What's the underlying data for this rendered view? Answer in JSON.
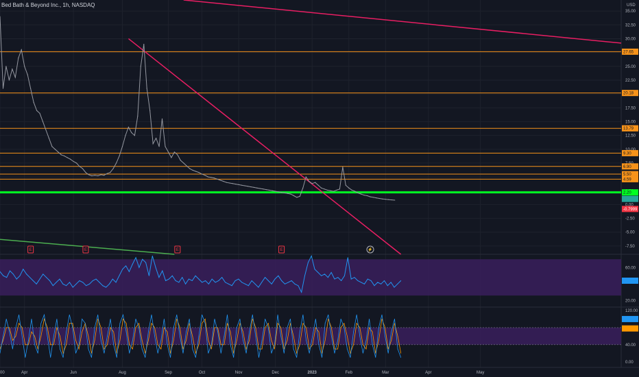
{
  "window": {
    "title": "Bed Bath & Beyond Inc., 1h, NASDAQ"
  },
  "colors": {
    "background": "#131722",
    "price": "#9598a1",
    "resistance": "#f7931a",
    "support": "#00ff22",
    "trendline": "#e91e63",
    "rsi_line": "#2196f3",
    "rsi_band": "#3a1f5c",
    "stoch_k": "#2196f3",
    "stoch_d": "#ff9800",
    "earnings": "#f23645"
  },
  "chart_data": [
    {
      "type": "line",
      "title": "Bed Bath & Beyond Inc., 1h, NASDAQ",
      "currency_label": "USD",
      "x_tick_labels": [
        "00",
        "Apr",
        "Jun",
        "Aug",
        "Sep",
        "Oct",
        "Nov",
        "Dec",
        "2023",
        "Feb",
        "Mar",
        "Apr",
        "May"
      ],
      "x_tick_index": [
        0,
        8,
        24,
        40,
        55,
        66,
        78,
        90,
        102,
        114,
        126,
        140,
        157
      ],
      "y_ticks": [
        35.0,
        32.5,
        30.0,
        27.5,
        25.0,
        22.5,
        20.0,
        17.5,
        15.0,
        12.5,
        10.0,
        7.5,
        5.0,
        2.5,
        0.0,
        -2.5,
        -5.0,
        -7.5
      ],
      "y_tick_labels": [
        "35.00",
        "32.50",
        "30.00",
        "27.50",
        "25.00",
        "22.50",
        "20.00",
        "17.50",
        "15.00",
        "12.50",
        "10.00",
        "7.50",
        "5.00",
        "2.50",
        "0.00",
        "-2.50",
        "-5.00",
        "-7.50"
      ],
      "ylim": [
        -9.0,
        37.0
      ],
      "price_series": [
        {
          "i": 0,
          "v": 34.0
        },
        {
          "i": 1,
          "v": 21.0
        },
        {
          "i": 2,
          "v": 25.0
        },
        {
          "i": 3,
          "v": 22.5
        },
        {
          "i": 4,
          "v": 24.5
        },
        {
          "i": 5,
          "v": 23.0
        },
        {
          "i": 6,
          "v": 26.5
        },
        {
          "i": 7,
          "v": 28.0
        },
        {
          "i": 8,
          "v": 25.0
        },
        {
          "i": 9,
          "v": 23.5
        },
        {
          "i": 10,
          "v": 21.0
        },
        {
          "i": 11,
          "v": 18.5
        },
        {
          "i": 12,
          "v": 17.0
        },
        {
          "i": 13,
          "v": 16.5
        },
        {
          "i": 14,
          "v": 15.0
        },
        {
          "i": 15,
          "v": 13.5
        },
        {
          "i": 16,
          "v": 12.0
        },
        {
          "i": 17,
          "v": 10.5
        },
        {
          "i": 18,
          "v": 10.0
        },
        {
          "i": 19,
          "v": 9.5
        },
        {
          "i": 20,
          "v": 9.0
        },
        {
          "i": 21,
          "v": 8.8
        },
        {
          "i": 22,
          "v": 8.5
        },
        {
          "i": 23,
          "v": 8.2
        },
        {
          "i": 24,
          "v": 7.8
        },
        {
          "i": 25,
          "v": 7.5
        },
        {
          "i": 26,
          "v": 6.9
        },
        {
          "i": 27,
          "v": 6.5
        },
        {
          "i": 28,
          "v": 5.8
        },
        {
          "i": 29,
          "v": 5.4
        },
        {
          "i": 30,
          "v": 5.2
        },
        {
          "i": 31,
          "v": 5.3
        },
        {
          "i": 32,
          "v": 5.2
        },
        {
          "i": 33,
          "v": 5.4
        },
        {
          "i": 34,
          "v": 5.3
        },
        {
          "i": 35,
          "v": 5.6
        },
        {
          "i": 36,
          "v": 5.8
        },
        {
          "i": 37,
          "v": 6.5
        },
        {
          "i": 38,
          "v": 7.5
        },
        {
          "i": 39,
          "v": 8.8
        },
        {
          "i": 40,
          "v": 10.5
        },
        {
          "i": 41,
          "v": 12.5
        },
        {
          "i": 42,
          "v": 14.0
        },
        {
          "i": 43,
          "v": 13.0
        },
        {
          "i": 44,
          "v": 12.5
        },
        {
          "i": 45,
          "v": 16.0
        },
        {
          "i": 46,
          "v": 25.0
        },
        {
          "i": 47,
          "v": 29.0
        },
        {
          "i": 48,
          "v": 21.0
        },
        {
          "i": 49,
          "v": 17.0
        },
        {
          "i": 50,
          "v": 11.0
        },
        {
          "i": 51,
          "v": 12.0
        },
        {
          "i": 52,
          "v": 10.5
        },
        {
          "i": 53,
          "v": 15.5
        },
        {
          "i": 54,
          "v": 10.5
        },
        {
          "i": 55,
          "v": 9.5
        },
        {
          "i": 56,
          "v": 8.5
        },
        {
          "i": 57,
          "v": 9.5
        },
        {
          "i": 58,
          "v": 9.0
        },
        {
          "i": 59,
          "v": 8.0
        },
        {
          "i": 60,
          "v": 7.5
        },
        {
          "i": 61,
          "v": 7.0
        },
        {
          "i": 62,
          "v": 6.5
        },
        {
          "i": 63,
          "v": 6.2
        },
        {
          "i": 64,
          "v": 6.0
        },
        {
          "i": 65,
          "v": 5.8
        },
        {
          "i": 66,
          "v": 5.5
        },
        {
          "i": 67,
          "v": 5.3
        },
        {
          "i": 68,
          "v": 5.0
        },
        {
          "i": 69,
          "v": 4.9
        },
        {
          "i": 70,
          "v": 4.8
        },
        {
          "i": 71,
          "v": 4.6
        },
        {
          "i": 72,
          "v": 4.4
        },
        {
          "i": 73,
          "v": 4.2
        },
        {
          "i": 74,
          "v": 4.0
        },
        {
          "i": 75,
          "v": 3.9
        },
        {
          "i": 76,
          "v": 3.8
        },
        {
          "i": 77,
          "v": 3.7
        },
        {
          "i": 78,
          "v": 3.6
        },
        {
          "i": 79,
          "v": 3.5
        },
        {
          "i": 80,
          "v": 3.4
        },
        {
          "i": 81,
          "v": 3.3
        },
        {
          "i": 82,
          "v": 3.2
        },
        {
          "i": 83,
          "v": 3.1
        },
        {
          "i": 84,
          "v": 3.0
        },
        {
          "i": 85,
          "v": 2.9
        },
        {
          "i": 86,
          "v": 2.8
        },
        {
          "i": 87,
          "v": 2.7
        },
        {
          "i": 88,
          "v": 2.6
        },
        {
          "i": 89,
          "v": 2.5
        },
        {
          "i": 90,
          "v": 2.4
        },
        {
          "i": 91,
          "v": 2.3
        },
        {
          "i": 92,
          "v": 2.2
        },
        {
          "i": 93,
          "v": 2.1
        },
        {
          "i": 94,
          "v": 2.0
        },
        {
          "i": 95,
          "v": 1.9
        },
        {
          "i": 96,
          "v": 1.6
        },
        {
          "i": 97,
          "v": 1.3
        },
        {
          "i": 98,
          "v": 1.5
        },
        {
          "i": 99,
          "v": 3.0
        },
        {
          "i": 100,
          "v": 5.0
        },
        {
          "i": 101,
          "v": 4.2
        },
        {
          "i": 102,
          "v": 3.8
        },
        {
          "i": 103,
          "v": 4.0
        },
        {
          "i": 104,
          "v": 3.5
        },
        {
          "i": 105,
          "v": 3.0
        },
        {
          "i": 106,
          "v": 2.8
        },
        {
          "i": 107,
          "v": 2.6
        },
        {
          "i": 108,
          "v": 2.5
        },
        {
          "i": 109,
          "v": 2.4
        },
        {
          "i": 110,
          "v": 2.6
        },
        {
          "i": 111,
          "v": 2.8
        },
        {
          "i": 112,
          "v": 6.8
        },
        {
          "i": 113,
          "v": 3.5
        },
        {
          "i": 114,
          "v": 3.0
        },
        {
          "i": 115,
          "v": 2.6
        },
        {
          "i": 116,
          "v": 2.4
        },
        {
          "i": 117,
          "v": 2.1
        },
        {
          "i": 118,
          "v": 1.9
        },
        {
          "i": 119,
          "v": 1.7
        },
        {
          "i": 120,
          "v": 1.6
        },
        {
          "i": 121,
          "v": 1.4
        },
        {
          "i": 122,
          "v": 1.3
        },
        {
          "i": 123,
          "v": 1.2
        },
        {
          "i": 124,
          "v": 1.1
        },
        {
          "i": 125,
          "v": 1.0
        },
        {
          "i": 126,
          "v": 0.95
        },
        {
          "i": 127,
          "v": 0.9
        },
        {
          "i": 128,
          "v": 0.85
        },
        {
          "i": 129,
          "v": 0.8
        }
      ],
      "resistance_levels": [
        {
          "value": 27.65,
          "label": "27.65"
        },
        {
          "value": 20.18,
          "label": "20.18"
        },
        {
          "value": 13.79,
          "label": "13.79"
        },
        {
          "value": 9.3,
          "label": "9.30"
        },
        {
          "value": 6.9,
          "label": "6.90"
        },
        {
          "value": 5.5,
          "label": "5.50"
        },
        {
          "value": 4.59,
          "label": "4.59"
        }
      ],
      "support_level": {
        "value": 2.2,
        "label": "2.20"
      },
      "last_price": {
        "value": -0.7999,
        "label": "-0.7999"
      },
      "trendlines": [
        {
          "name": "upper",
          "from": {
            "i": 60,
            "v": 37.0
          },
          "to": {
            "i": 203,
            "v": 29.2
          }
        },
        {
          "name": "falling",
          "from": {
            "i": 42,
            "v": 30.0
          },
          "to": {
            "i": 131,
            "v": -9.0
          }
        },
        {
          "name": "green",
          "from": {
            "i": 0,
            "v": -6.3
          },
          "to": {
            "i": 57,
            "v": -9.0
          }
        }
      ],
      "events": [
        {
          "i": 10,
          "label": "E",
          "kind": "earnings"
        },
        {
          "i": 28,
          "label": "E",
          "kind": "earnings"
        },
        {
          "i": 58,
          "label": "E",
          "kind": "earnings"
        },
        {
          "i": 92,
          "label": "E",
          "kind": "earnings"
        },
        {
          "i": 121,
          "label": "⚡",
          "kind": "news"
        }
      ]
    },
    {
      "type": "line",
      "title": "",
      "name": "RSI",
      "y_ticks": [
        60.0,
        20.0
      ],
      "y_tick_labels": [
        "60.00",
        "20.00"
      ],
      "ylim": [
        12,
        76
      ],
      "band": [
        26,
        70
      ],
      "last_value_label": "",
      "values": [
        55,
        50,
        48,
        56,
        52,
        46,
        50,
        58,
        52,
        48,
        44,
        40,
        46,
        52,
        48,
        44,
        38,
        42,
        46,
        40,
        38,
        42,
        36,
        40,
        44,
        42,
        38,
        40,
        44,
        46,
        42,
        38,
        36,
        40,
        46,
        42,
        50,
        58,
        62,
        55,
        64,
        72,
        60,
        70,
        66,
        50,
        74,
        60,
        48,
        56,
        44,
        46,
        50,
        44,
        42,
        48,
        40,
        46,
        44,
        50,
        46,
        42,
        44,
        40,
        46,
        42,
        44,
        48,
        42,
        40,
        38,
        44,
        46,
        42,
        40,
        38,
        44,
        40,
        36,
        42,
        48,
        44,
        40,
        46,
        50,
        44,
        40,
        42,
        44,
        40,
        38,
        30,
        50,
        66,
        74,
        58,
        54,
        50,
        52,
        48,
        54,
        46,
        48,
        44,
        50,
        72,
        46,
        48,
        44,
        42,
        40,
        46,
        44,
        38,
        42,
        40,
        44,
        38,
        42,
        36,
        40,
        44
      ]
    },
    {
      "type": "line",
      "title": "",
      "name": "Stoch RSI",
      "y_ticks": [
        120.0,
        40.0,
        0.0
      ],
      "y_tick_labels": [
        "120.00",
        "40.00",
        "0.00"
      ],
      "ylim": [
        -10,
        128
      ],
      "band": [
        40,
        80
      ],
      "k_values": [
        20,
        60,
        100,
        70,
        30,
        80,
        110,
        60,
        10,
        50,
        100,
        40,
        20,
        90,
        110,
        60,
        10,
        60,
        100,
        30,
        10,
        70,
        110,
        80,
        20,
        40,
        100,
        90,
        30,
        10,
        80,
        110,
        50,
        20,
        60,
        100,
        40,
        10,
        90,
        110,
        70,
        20,
        50,
        100,
        80,
        30,
        10,
        70,
        110,
        60,
        20,
        50,
        100,
        40,
        10,
        80,
        110,
        60,
        20,
        70,
        100,
        30,
        10,
        60,
        110,
        90,
        20,
        40,
        100,
        70,
        20,
        60,
        110,
        40,
        10,
        80,
        100,
        50,
        20,
        70,
        110,
        60,
        10,
        50,
        100,
        80,
        20,
        40,
        110,
        60,
        20,
        80,
        100,
        30,
        10,
        70,
        110,
        50,
        20,
        60,
        100,
        40,
        10,
        90,
        110,
        60,
        20,
        50,
        100,
        80,
        30,
        10,
        70,
        110,
        60,
        20,
        50,
        100,
        40,
        10,
        80,
        110,
        60,
        20,
        70,
        100,
        30,
        10
      ],
      "d_values": [
        30,
        50,
        80,
        80,
        50,
        60,
        90,
        80,
        40,
        40,
        70,
        60,
        30,
        60,
        100,
        80,
        40,
        40,
        80,
        60,
        20,
        40,
        90,
        90,
        50,
        30,
        70,
        90,
        60,
        20,
        50,
        100,
        80,
        30,
        40,
        80,
        70,
        20,
        50,
        100,
        90,
        40,
        30,
        80,
        90,
        50,
        20,
        50,
        90,
        80,
        40,
        30,
        80,
        70,
        20,
        50,
        100,
        80,
        30,
        50,
        90,
        60,
        20,
        40,
        90,
        100,
        50,
        30,
        80,
        80,
        40,
        40,
        90,
        70,
        20,
        50,
        90,
        70,
        30,
        50,
        100,
        80,
        30,
        30,
        80,
        90,
        50,
        30,
        90,
        80,
        30,
        50,
        90,
        60,
        20,
        40,
        90,
        80,
        30,
        40,
        80,
        70,
        20,
        50,
        100,
        80,
        30,
        30,
        80,
        90,
        60,
        20,
        40,
        90,
        80,
        40,
        30,
        80,
        70,
        20,
        50,
        100,
        80,
        30,
        50,
        90,
        60,
        20
      ]
    }
  ]
}
